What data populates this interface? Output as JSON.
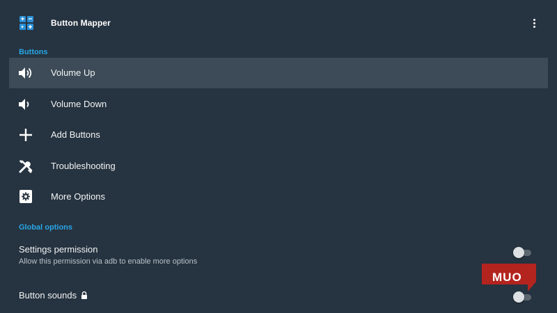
{
  "app": {
    "title": "Button Mapper",
    "icon": "app-grid-icon",
    "menu_icon": "more-vert-icon"
  },
  "sections": {
    "buttons_header": "Buttons",
    "global_header": "Global options"
  },
  "buttons": [
    {
      "label": "Volume Up",
      "icon": "volume-up-icon",
      "selected": true
    },
    {
      "label": "Volume Down",
      "icon": "volume-down-icon",
      "selected": false
    },
    {
      "label": "Add Buttons",
      "icon": "plus-icon",
      "selected": false
    },
    {
      "label": "Troubleshooting",
      "icon": "tools-icon",
      "selected": false
    },
    {
      "label": "More Options",
      "icon": "settings-box-icon",
      "selected": false
    }
  ],
  "global_options": [
    {
      "title": "Settings permission",
      "subtitle": "Allow this permission via adb to enable more options",
      "enabled": false
    },
    {
      "title": "Button sounds",
      "icon": "lock-icon",
      "enabled": false
    }
  ],
  "watermark": {
    "text": "MUO"
  },
  "colors": {
    "background": "#263340",
    "selected_row": "#3c4b57",
    "accent": "#29a6e6",
    "watermark": "#b3241f"
  }
}
